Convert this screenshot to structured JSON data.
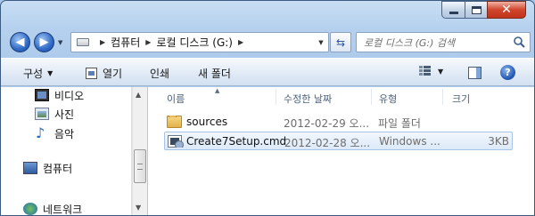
{
  "window": {
    "address_path": [
      "컴퓨터",
      "로컬 디스크 (G:)"
    ],
    "search_placeholder": "로컬 디스크 (G:) 검색",
    "close_glyph": "✕"
  },
  "toolbar": {
    "organize": "구성",
    "open": "열기",
    "print": "인쇄",
    "new_folder": "새 폴더",
    "help_glyph": "?"
  },
  "nav_pane": {
    "items": [
      {
        "label": "비디오",
        "icon": "video-library-icon"
      },
      {
        "label": "사진",
        "icon": "pictures-library-icon"
      },
      {
        "label": "음악",
        "icon": "music-library-icon"
      },
      {
        "label": "컴퓨터",
        "icon": "computer-icon"
      },
      {
        "label": "네트워크",
        "icon": "network-icon"
      }
    ]
  },
  "file_list": {
    "columns": {
      "name": "이름",
      "modified": "수정한 날짜",
      "type": "유형",
      "size": "크기"
    },
    "rows": [
      {
        "name": "sources",
        "modified": "2012-02-29 오...",
        "type": "파일 폴더",
        "size": "",
        "icon": "folder-icon"
      },
      {
        "name": "Create7Setup.cmd",
        "modified": "2012-02-28 오...",
        "type": "Windows ...",
        "size": "3KB",
        "icon": "cmd-file-icon",
        "selected": true
      }
    ]
  },
  "colors": {
    "titlebar": "#b6d1ee",
    "selection": "#dce9f8",
    "close_button": "#c0331c"
  }
}
